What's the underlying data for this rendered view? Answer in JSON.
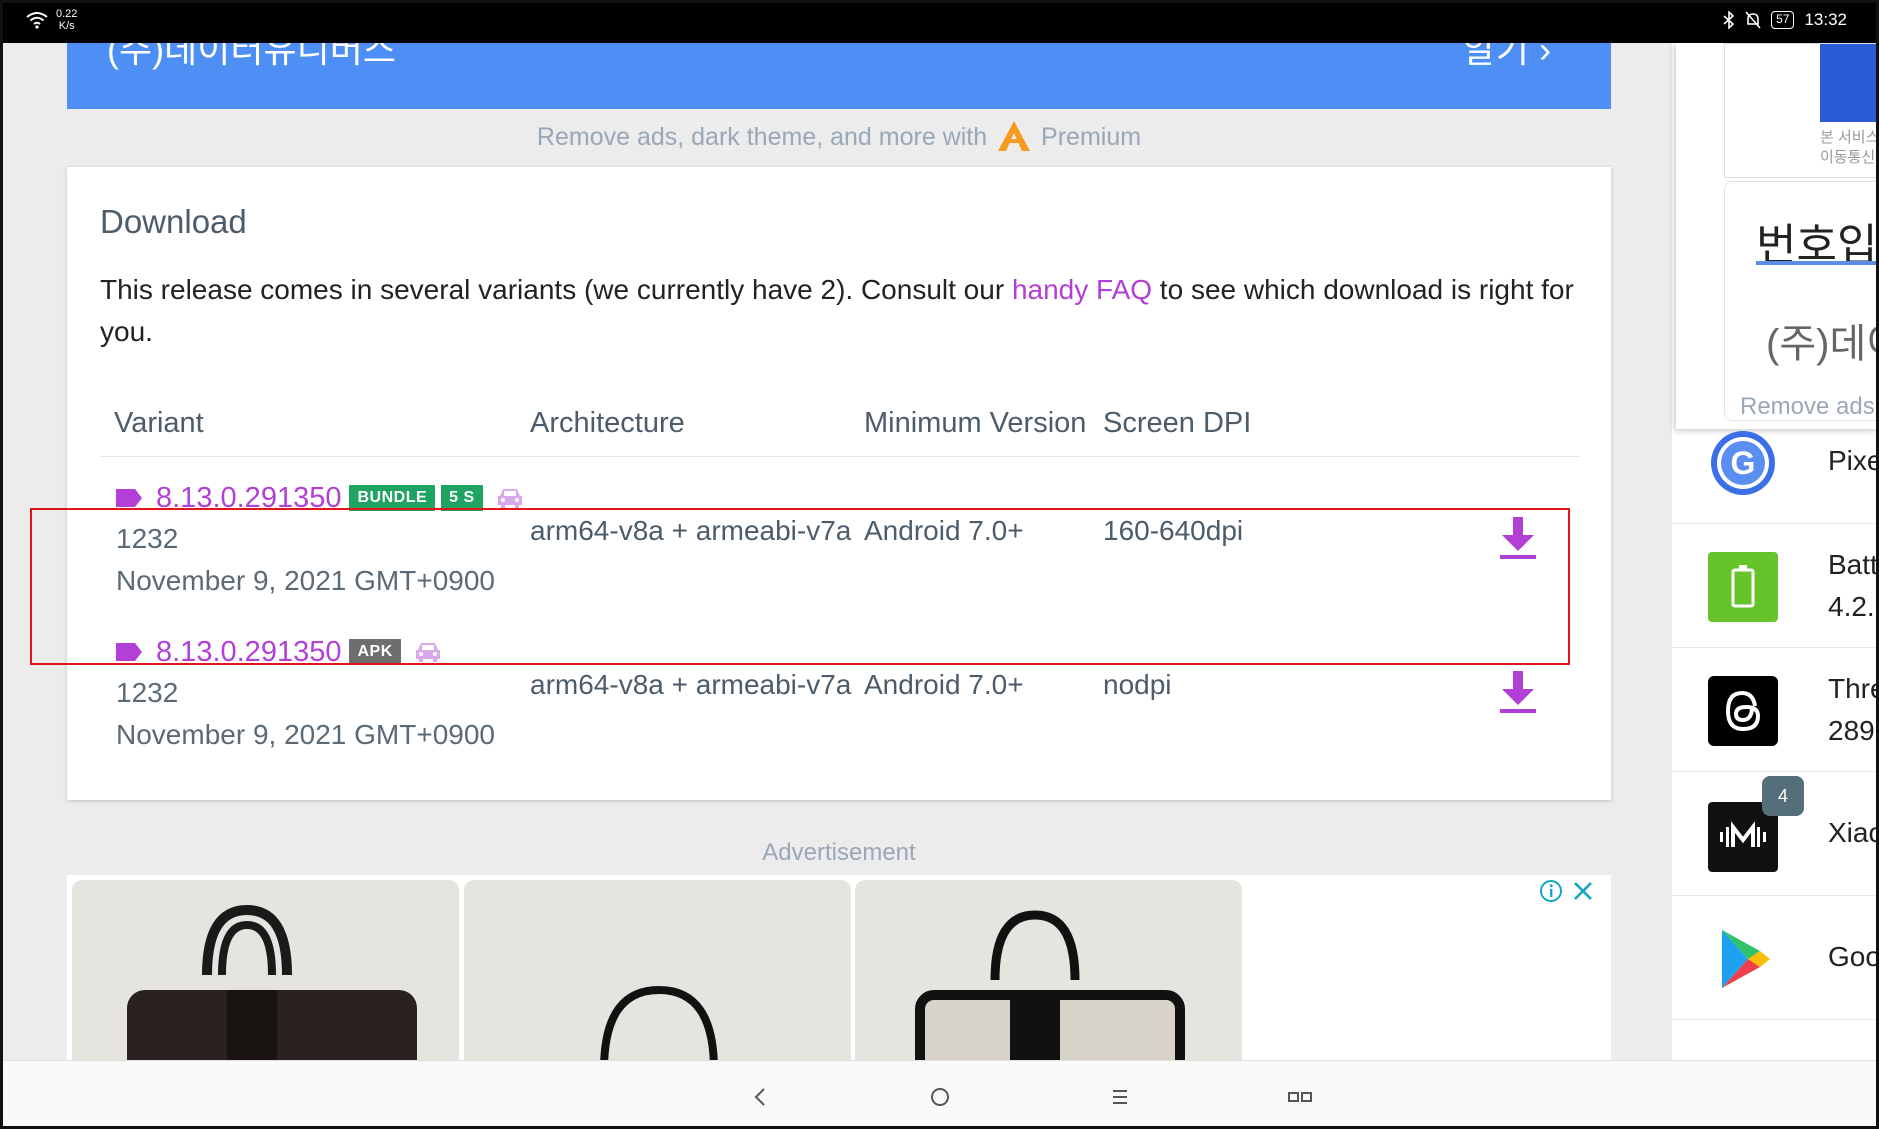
{
  "status_bar": {
    "net_speed_value": "0.22",
    "net_speed_unit": "K/s",
    "battery": "57",
    "time": "13:32"
  },
  "banner": {
    "text": "(주)데이터유니버스",
    "cta": "알기"
  },
  "premium": {
    "prefix": "Remove ads, dark theme, and more with",
    "suffix": "Premium"
  },
  "download": {
    "title": "Download",
    "desc_before": "This release comes in several variants (we currently have 2). Consult our ",
    "desc_link": "handy FAQ",
    "desc_after": " to see which download is right for you.",
    "columns": {
      "variant": "Variant",
      "architecture": "Architecture",
      "min_version": "Minimum Version",
      "screen_dpi": "Screen DPI"
    },
    "rows": [
      {
        "version": "8.13.0.291350",
        "badges": [
          "BUNDLE",
          "5 S"
        ],
        "version_code": "1232",
        "date": "November 9, 2021 GMT+0900",
        "architecture": "arm64-v8a + armeabi-v7a",
        "min_version": "Android 7.0+",
        "dpi": "160-640dpi"
      },
      {
        "version": "8.13.0.291350",
        "badges": [
          "APK"
        ],
        "version_code": "1232",
        "date": "November 9, 2021 GMT+0900",
        "architecture": "arm64-v8a + armeabi-v7a",
        "min_version": "Android 7.0+",
        "dpi": "nodpi"
      }
    ]
  },
  "advertisement": {
    "label": "Advertisement"
  },
  "side_popup": {
    "small_text_1": "본 서비스",
    "small_text_2": "이동통신",
    "number_label": "번호입",
    "company": "(주)데이",
    "remove_ads": "Remove ads"
  },
  "side_apps": [
    {
      "icon": "google-icon",
      "line1": "Pixe",
      "line2": ""
    },
    {
      "icon": "battery-icon",
      "line1": "Batt",
      "line2": "4.2."
    },
    {
      "icon": "threads-icon",
      "line1": "Thre",
      "line2": "289"
    },
    {
      "icon": "xiaomi-music-icon",
      "line1": "Xiac",
      "line2": "",
      "count": "4"
    },
    {
      "icon": "google-play-icon",
      "line1": "Goo",
      "line2": ""
    }
  ],
  "colors": {
    "accent_purple": "#b23fd6",
    "badge_green": "#1ea362",
    "badge_gray": "#6e6e6e",
    "banner_blue": "#4e8ff5",
    "highlight_red": "#e0161c"
  }
}
